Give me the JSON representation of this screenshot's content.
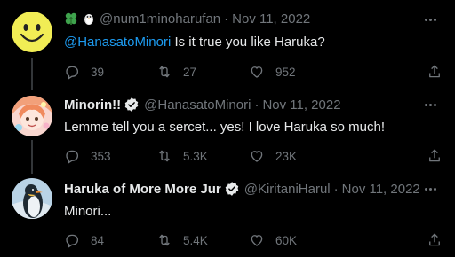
{
  "colors": {
    "background": "#000000",
    "text": "#e7e9ea",
    "muted": "#71767b",
    "link": "#1d9bf0",
    "thread_line": "#333639"
  },
  "tweets": [
    {
      "name": "",
      "emoji_prefix": [
        "four-leaf-clover-icon",
        "penguin-icon"
      ],
      "handle": "@num1minoharufan",
      "date": "Nov 11, 2022",
      "mention": "@HanasatoMinori",
      "text": " Is it true you like Haruka?",
      "replies": "39",
      "retweets": "27",
      "likes": "952",
      "avatar": "smiley-face-avatar"
    },
    {
      "name": "Minorin!!",
      "verified": true,
      "handle": "@HanasatoMinori",
      "date": "Nov 11, 2022",
      "text": "Lemme tell you a sercet... yes! I love Haruka so much!",
      "replies": "353",
      "retweets": "5.3K",
      "likes": "23K",
      "avatar": "minori-avatar"
    },
    {
      "name": "Haruka of More More Jur",
      "verified": true,
      "handle": "@KiritaniHarul",
      "date": "Nov 11, 2022",
      "text": "Minori...",
      "replies": "84",
      "retweets": "5.4K",
      "likes": "60K",
      "avatar": "penguin-avatar"
    }
  ],
  "separator": "·"
}
